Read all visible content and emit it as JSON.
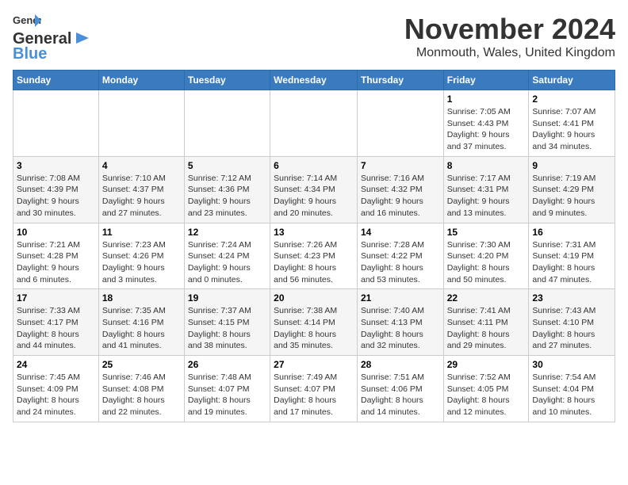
{
  "logo": {
    "line1": "General",
    "line2": "Blue"
  },
  "title": "November 2024",
  "location": "Monmouth, Wales, United Kingdom",
  "days_of_week": [
    "Sunday",
    "Monday",
    "Tuesday",
    "Wednesday",
    "Thursday",
    "Friday",
    "Saturday"
  ],
  "weeks": [
    [
      {
        "day": "",
        "info": ""
      },
      {
        "day": "",
        "info": ""
      },
      {
        "day": "",
        "info": ""
      },
      {
        "day": "",
        "info": ""
      },
      {
        "day": "",
        "info": ""
      },
      {
        "day": "1",
        "info": "Sunrise: 7:05 AM\nSunset: 4:43 PM\nDaylight: 9 hours\nand 37 minutes."
      },
      {
        "day": "2",
        "info": "Sunrise: 7:07 AM\nSunset: 4:41 PM\nDaylight: 9 hours\nand 34 minutes."
      }
    ],
    [
      {
        "day": "3",
        "info": "Sunrise: 7:08 AM\nSunset: 4:39 PM\nDaylight: 9 hours\nand 30 minutes."
      },
      {
        "day": "4",
        "info": "Sunrise: 7:10 AM\nSunset: 4:37 PM\nDaylight: 9 hours\nand 27 minutes."
      },
      {
        "day": "5",
        "info": "Sunrise: 7:12 AM\nSunset: 4:36 PM\nDaylight: 9 hours\nand 23 minutes."
      },
      {
        "day": "6",
        "info": "Sunrise: 7:14 AM\nSunset: 4:34 PM\nDaylight: 9 hours\nand 20 minutes."
      },
      {
        "day": "7",
        "info": "Sunrise: 7:16 AM\nSunset: 4:32 PM\nDaylight: 9 hours\nand 16 minutes."
      },
      {
        "day": "8",
        "info": "Sunrise: 7:17 AM\nSunset: 4:31 PM\nDaylight: 9 hours\nand 13 minutes."
      },
      {
        "day": "9",
        "info": "Sunrise: 7:19 AM\nSunset: 4:29 PM\nDaylight: 9 hours\nand 9 minutes."
      }
    ],
    [
      {
        "day": "10",
        "info": "Sunrise: 7:21 AM\nSunset: 4:28 PM\nDaylight: 9 hours\nand 6 minutes."
      },
      {
        "day": "11",
        "info": "Sunrise: 7:23 AM\nSunset: 4:26 PM\nDaylight: 9 hours\nand 3 minutes."
      },
      {
        "day": "12",
        "info": "Sunrise: 7:24 AM\nSunset: 4:24 PM\nDaylight: 9 hours\nand 0 minutes."
      },
      {
        "day": "13",
        "info": "Sunrise: 7:26 AM\nSunset: 4:23 PM\nDaylight: 8 hours\nand 56 minutes."
      },
      {
        "day": "14",
        "info": "Sunrise: 7:28 AM\nSunset: 4:22 PM\nDaylight: 8 hours\nand 53 minutes."
      },
      {
        "day": "15",
        "info": "Sunrise: 7:30 AM\nSunset: 4:20 PM\nDaylight: 8 hours\nand 50 minutes."
      },
      {
        "day": "16",
        "info": "Sunrise: 7:31 AM\nSunset: 4:19 PM\nDaylight: 8 hours\nand 47 minutes."
      }
    ],
    [
      {
        "day": "17",
        "info": "Sunrise: 7:33 AM\nSunset: 4:17 PM\nDaylight: 8 hours\nand 44 minutes."
      },
      {
        "day": "18",
        "info": "Sunrise: 7:35 AM\nSunset: 4:16 PM\nDaylight: 8 hours\nand 41 minutes."
      },
      {
        "day": "19",
        "info": "Sunrise: 7:37 AM\nSunset: 4:15 PM\nDaylight: 8 hours\nand 38 minutes."
      },
      {
        "day": "20",
        "info": "Sunrise: 7:38 AM\nSunset: 4:14 PM\nDaylight: 8 hours\nand 35 minutes."
      },
      {
        "day": "21",
        "info": "Sunrise: 7:40 AM\nSunset: 4:13 PM\nDaylight: 8 hours\nand 32 minutes."
      },
      {
        "day": "22",
        "info": "Sunrise: 7:41 AM\nSunset: 4:11 PM\nDaylight: 8 hours\nand 29 minutes."
      },
      {
        "day": "23",
        "info": "Sunrise: 7:43 AM\nSunset: 4:10 PM\nDaylight: 8 hours\nand 27 minutes."
      }
    ],
    [
      {
        "day": "24",
        "info": "Sunrise: 7:45 AM\nSunset: 4:09 PM\nDaylight: 8 hours\nand 24 minutes."
      },
      {
        "day": "25",
        "info": "Sunrise: 7:46 AM\nSunset: 4:08 PM\nDaylight: 8 hours\nand 22 minutes."
      },
      {
        "day": "26",
        "info": "Sunrise: 7:48 AM\nSunset: 4:07 PM\nDaylight: 8 hours\nand 19 minutes."
      },
      {
        "day": "27",
        "info": "Sunrise: 7:49 AM\nSunset: 4:07 PM\nDaylight: 8 hours\nand 17 minutes."
      },
      {
        "day": "28",
        "info": "Sunrise: 7:51 AM\nSunset: 4:06 PM\nDaylight: 8 hours\nand 14 minutes."
      },
      {
        "day": "29",
        "info": "Sunrise: 7:52 AM\nSunset: 4:05 PM\nDaylight: 8 hours\nand 12 minutes."
      },
      {
        "day": "30",
        "info": "Sunrise: 7:54 AM\nSunset: 4:04 PM\nDaylight: 8 hours\nand 10 minutes."
      }
    ]
  ]
}
